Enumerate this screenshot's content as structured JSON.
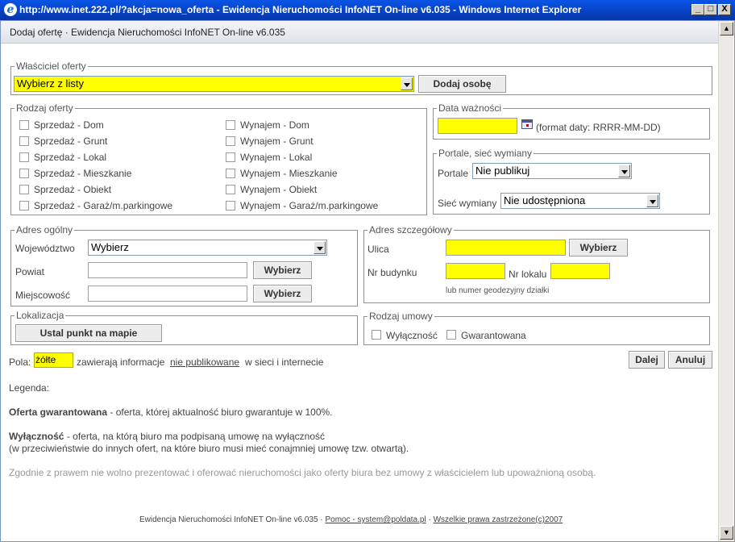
{
  "window": {
    "title": "http://www.inet.222.pl/?akcja=nowa_oferta - Ewidencja Nieruchomości InfoNET On-line v6.035 - Windows Internet Explorer",
    "header": "Dodaj ofertę · Ewidencja Nieruchomości InfoNET On-line v6.035",
    "btn_min": "_",
    "btn_max": "□",
    "btn_close": "X"
  },
  "owner": {
    "legend": "Właściciel oferty",
    "select_value": "Wybierz z listy",
    "add_button": "Dodaj osobę"
  },
  "offer_type": {
    "legend": "Rodzaj oferty",
    "sale": [
      "Sprzedaż - Dom",
      "Sprzedaż - Grunt",
      "Sprzedaż - Lokal",
      "Sprzedaż - Mieszkanie",
      "Sprzedaż - Obiekt",
      "Sprzedaż - Garaż/m.parkingowe"
    ],
    "rent": [
      "Wynajem - Dom",
      "Wynajem - Grunt",
      "Wynajem - Lokal",
      "Wynajem - Mieszkanie",
      "Wynajem - Obiekt",
      "Wynajem - Garaż/m.parkingowe"
    ]
  },
  "validity": {
    "legend": "Data ważności",
    "value": "",
    "format_hint": "(format daty: RRRR-MM-DD)"
  },
  "portals": {
    "legend": "Portale, sieć wymiany",
    "portal_label": "Portale",
    "portal_value": "Nie publikuj",
    "network_label": "Sieć wymiany",
    "network_value": "Nie udostępniona"
  },
  "general_address": {
    "legend": "Adres ogólny",
    "voivodeship_label": "Województwo",
    "voivodeship_value": "Wybierz",
    "county_label": "Powiat",
    "county_value": "",
    "city_label": "Miejscowość",
    "city_value": "",
    "choose_button": "Wybierz"
  },
  "detail_address": {
    "legend": "Adres szczegółowy",
    "street_label": "Ulica",
    "street_value": "",
    "choose_button": "Wybierz",
    "building_label": "Nr budynku",
    "building_value": "",
    "unit_label": "Nr lokalu",
    "unit_value": "",
    "geodetic_hint": "lub numer geodezyjny działki"
  },
  "location": {
    "legend": "Lokalizacja",
    "map_button": "Ustal punkt na mapie"
  },
  "contract": {
    "legend": "Rodzaj umowy",
    "options": [
      "Wyłączność",
      "Gwarantowana"
    ]
  },
  "fields_note": {
    "prefix": "Pola:",
    "yellow_word": "żółte",
    "middle": "zawierają informacje",
    "link": "nie publikowane",
    "suffix": "w sieci i internecie"
  },
  "actions": {
    "next": "Dalej",
    "cancel": "Anuluj"
  },
  "legend_section": {
    "title": "Legenda:",
    "guaranteed_term": "Oferta gwarantowana",
    "guaranteed_desc": " - oferta, której aktualność biuro gwarantuje w 100%.",
    "exclusive_term": "Wyłączność",
    "exclusive_desc": " - oferta, na którą biuro ma podpisaną umowę na wyłączność",
    "exclusive_desc2": "(w przeciwieństwie do innych ofert, na które biuro musi mieć conajmniej umowę tzw. otwartą).",
    "law_note": "Zgodnie z prawem nie wolno prezentować i oferować nieruchomości jako oferty biura bez umowy z właścicielem lub upoważnioną osobą."
  },
  "footer": {
    "app": "Ewidencja Nieruchomości InfoNET On-line v6.035 ·",
    "help": "Pomoc - system@poldata.pl",
    "sep": "·",
    "rights": "Wszelkie prawa zastrzeżone(c)2007"
  },
  "colors": {
    "required_yellow": "#ffff00",
    "titlebar_blue": "#0a54e6"
  }
}
